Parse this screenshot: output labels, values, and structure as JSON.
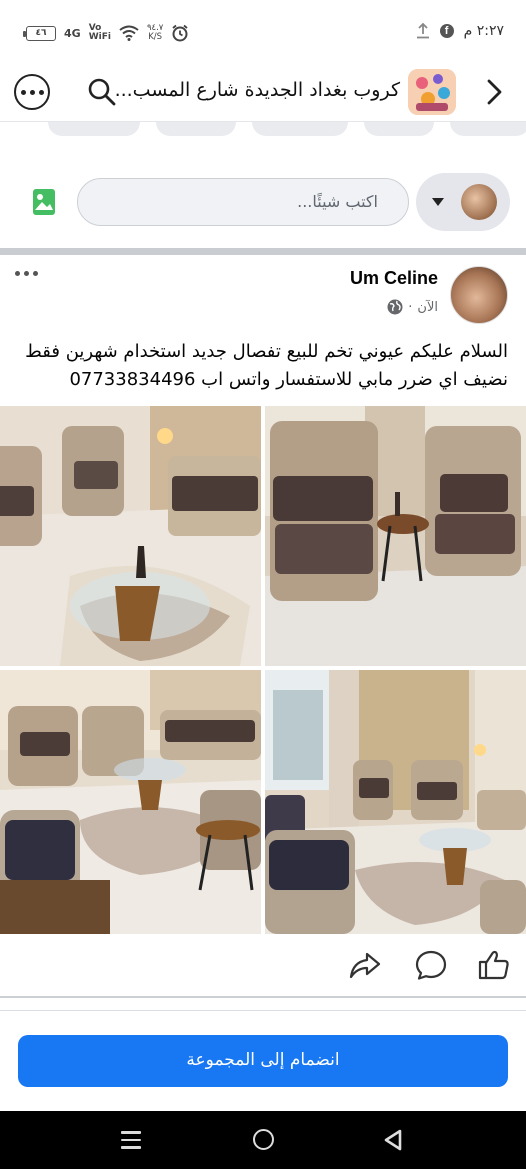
{
  "status_bar": {
    "battery": "٤٦",
    "network": "4G",
    "vowifi_top": "Vo",
    "vowifi_bottom": "WiFi",
    "speed_value": "٩٤.٧",
    "speed_unit": "K/S",
    "time": "٢:٢٧ م"
  },
  "header": {
    "title": "كروب بغداد الجديدة شارع المسب..."
  },
  "composer": {
    "placeholder": "اكتب شيئًا..."
  },
  "post": {
    "author": "Um Celine",
    "time": "الآن",
    "separator": "·",
    "text": "السلام عليكم عيوني تخم للبيع تفصال جديد استخدام شهرين فقط نضيف اي ضرر مابي للاستفسار واتس اب 07733834496"
  },
  "join": {
    "label": "انضمام إلى المجموعة"
  },
  "icons": {
    "more": "more-options-icon",
    "search": "search-icon",
    "back": "chevron-left-icon",
    "photo": "photo-icon",
    "globe": "globe-icon",
    "share": "share-icon",
    "comment": "comment-icon",
    "like": "like-icon"
  },
  "colors": {
    "accent": "#1877f2",
    "separator": "#c9ccd1"
  }
}
